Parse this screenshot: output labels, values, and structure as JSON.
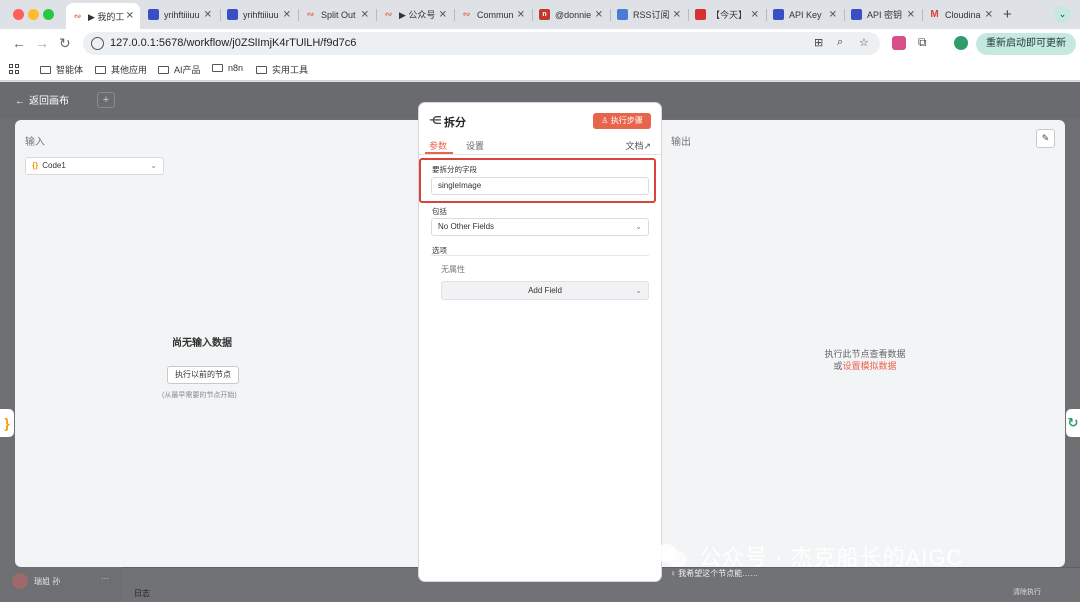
{
  "browser": {
    "tabs": [
      {
        "label": "▶ 我的工",
        "color": "#e8654d",
        "active": true
      },
      {
        "label": "yrihftiiiuu",
        "color": "#3b4fc4"
      },
      {
        "label": "yrihftiiiuu",
        "color": "#3b4fc4"
      },
      {
        "label": "Split Out",
        "color": "#e8654d"
      },
      {
        "label": "▶ 公众号",
        "color": "#e8654d"
      },
      {
        "label": "Community",
        "color": "#e8654d"
      },
      {
        "label": "@donnie",
        "color": "#c0392b"
      },
      {
        "label": "RSS订阅",
        "color": "#4a7cd6"
      },
      {
        "label": "【今天】",
        "color": "#d6322f"
      },
      {
        "label": "API Key",
        "color": "#3b4fc4"
      },
      {
        "label": "API 密钥",
        "color": "#3b4fc4"
      },
      {
        "label": "Cloudinary",
        "color": "#d44638"
      }
    ],
    "address": {
      "url": "127.0.0.1:5678/workflow/j0ZSlImjK4rTUlLH/f9d7c6",
      "update_button": "重新启动即可更新"
    },
    "bookmarks": [
      "智能体",
      "其他应用",
      "AI产品",
      "n8n",
      "实用工具"
    ]
  },
  "app": {
    "back_link": "返回画布",
    "input_panel": {
      "title": "输入",
      "node_select": "Code1",
      "empty_title": "尚无输入数据",
      "exec_prev_button": "执行以前的节点",
      "hint": "(从最早需要的节点开始)"
    },
    "output_panel": {
      "title": "输出",
      "message": "执行此节点查看数据",
      "or_text": "或",
      "mock_link": "设置模拟数据"
    },
    "node": {
      "title": "拆分",
      "exec_step_button": "执行步骤",
      "tabs": [
        "参数",
        "设置"
      ],
      "docs_link": "文档",
      "field_to_split_label": "要拆分的字段",
      "field_to_split_value": "singleImage",
      "include_label": "包括",
      "include_value": "No Other Fields",
      "options_label": "选项",
      "no_properties": "无属性",
      "add_field_button": "Add Field"
    },
    "bottom": {
      "user_name": "瑞姐 孙",
      "log_label": "日志",
      "ask_ai": "我希望这个节点能……",
      "right_text": "清除执行"
    }
  },
  "watermark": "公众号 · 杰克船长的AIGC"
}
